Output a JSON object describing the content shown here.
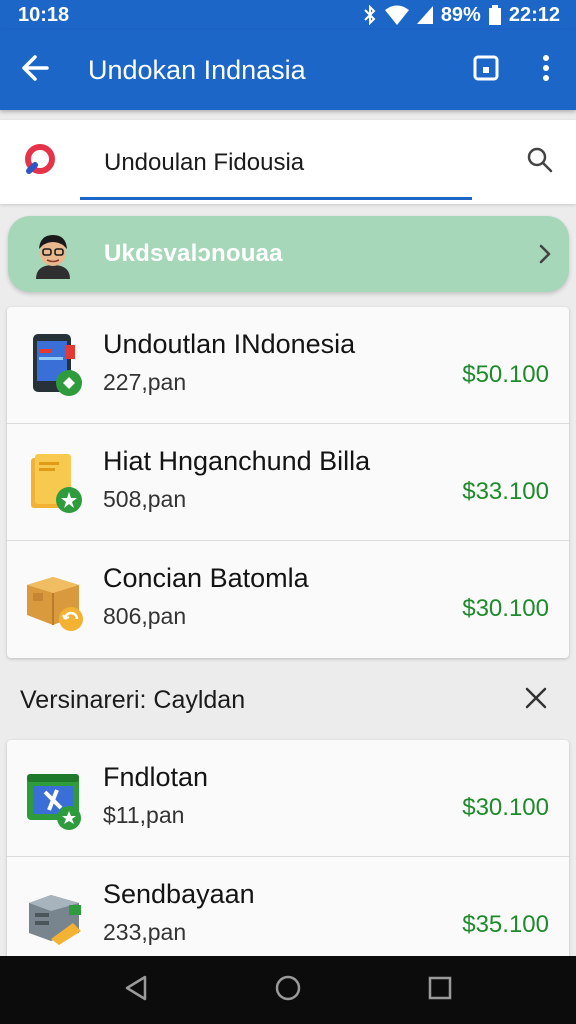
{
  "status_bar": {
    "time_left": "10:18",
    "battery": "89%",
    "time_right": "22:12"
  },
  "app_bar": {
    "title": "Undokan Indnasia",
    "icons": [
      "back-arrow-icon",
      "bookmark-icon",
      "more-vert-icon"
    ]
  },
  "search": {
    "value": "Undoulan Fidousia",
    "icon": "search-icon"
  },
  "promo": {
    "label": "Ukdsvalɔnouaa",
    "icon": "chevron-right-icon"
  },
  "products": [
    {
      "title": "Undoutlan INdonesia",
      "subtitle": "227,pan",
      "price": "$50.100",
      "icon": "phone-icon"
    },
    {
      "title": "Hiat Hnganchund Billa",
      "subtitle": "508,pan",
      "price": "$33.100",
      "icon": "folder-icon"
    },
    {
      "title": "Concian Batomla",
      "subtitle": "806,pan",
      "price": "$30.100",
      "icon": "package-icon"
    }
  ],
  "section": {
    "title": "Versinareri: Cayldan",
    "close_icon": "close-icon"
  },
  "products_2": [
    {
      "title": "Fndlotan",
      "subtitle": "$11,pan",
      "price": "$30.100",
      "icon": "app-window-icon"
    },
    {
      "title": "Sendbayaan",
      "subtitle": "233,pan",
      "price": "$35.100",
      "icon": "device-icon"
    }
  ],
  "nav_bar": {
    "icons": [
      "nav-back-icon",
      "nav-home-icon",
      "nav-recents-icon"
    ]
  },
  "colors": {
    "primary": "#1c66c8",
    "promo_bg": "#a6d7b9",
    "price": "#1e8a2c",
    "background": "#ececec",
    "nav_bar": "#0c0c0c"
  }
}
